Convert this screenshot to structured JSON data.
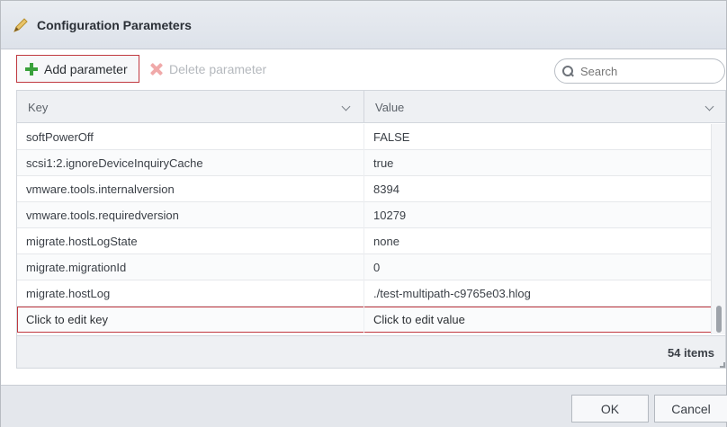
{
  "dialog": {
    "title": "Configuration Parameters",
    "title_icon": "pencil-icon"
  },
  "toolbar": {
    "add_label": "Add parameter",
    "delete_label": "Delete parameter",
    "search_placeholder": "Search",
    "add_icon_color": "#3aa13c",
    "delete_icon_color": "#f0a9a9"
  },
  "grid": {
    "columns": [
      "Key",
      "Value"
    ],
    "rows": [
      {
        "key": "softPowerOff",
        "value": "FALSE"
      },
      {
        "key": "scsi1:2.ignoreDeviceInquiryCache",
        "value": "true"
      },
      {
        "key": "vmware.tools.internalversion",
        "value": "8394"
      },
      {
        "key": "vmware.tools.requiredversion",
        "value": "10279"
      },
      {
        "key": "migrate.hostLogState",
        "value": "none"
      },
      {
        "key": "migrate.migrationId",
        "value": "0"
      },
      {
        "key": "migrate.hostLog",
        "value": "./test-multipath-c9765e03.hlog"
      }
    ],
    "edit_row": {
      "key": "Click to edit key",
      "value": "Click to edit value"
    },
    "items_count": "54 items",
    "highlight_color": "#c0383f"
  },
  "footer": {
    "ok_label": "OK",
    "cancel_label": "Cancel"
  }
}
